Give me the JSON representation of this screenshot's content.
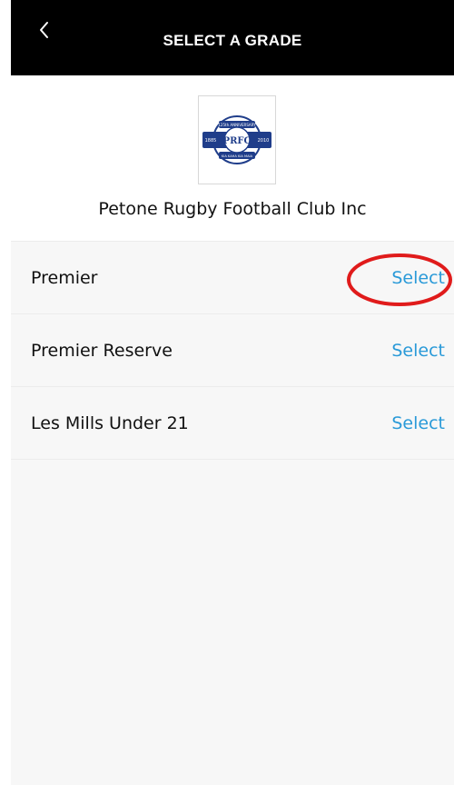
{
  "header": {
    "title": "SELECT A GRADE",
    "back_icon": "chevron-left-icon"
  },
  "club": {
    "name": "Petone Rugby Football Club Inc",
    "logo": {
      "top_text": "125th ANNIVERSARY",
      "left_year": "1885",
      "right_year": "2010",
      "bottom_text": "KIA KAHA KIA MAIA",
      "monogram": "PRFC",
      "color": "#1f3d8a"
    }
  },
  "grades": [
    {
      "label": "Premier",
      "action": "Select"
    },
    {
      "label": "Premier Reserve",
      "action": "Select"
    },
    {
      "label": "Les Mills Under 21",
      "action": "Select"
    }
  ],
  "colors": {
    "header_bg": "#000000",
    "link": "#2a9ad8",
    "list_bg": "#f7f7f7",
    "annotation": "#e01b1b"
  }
}
